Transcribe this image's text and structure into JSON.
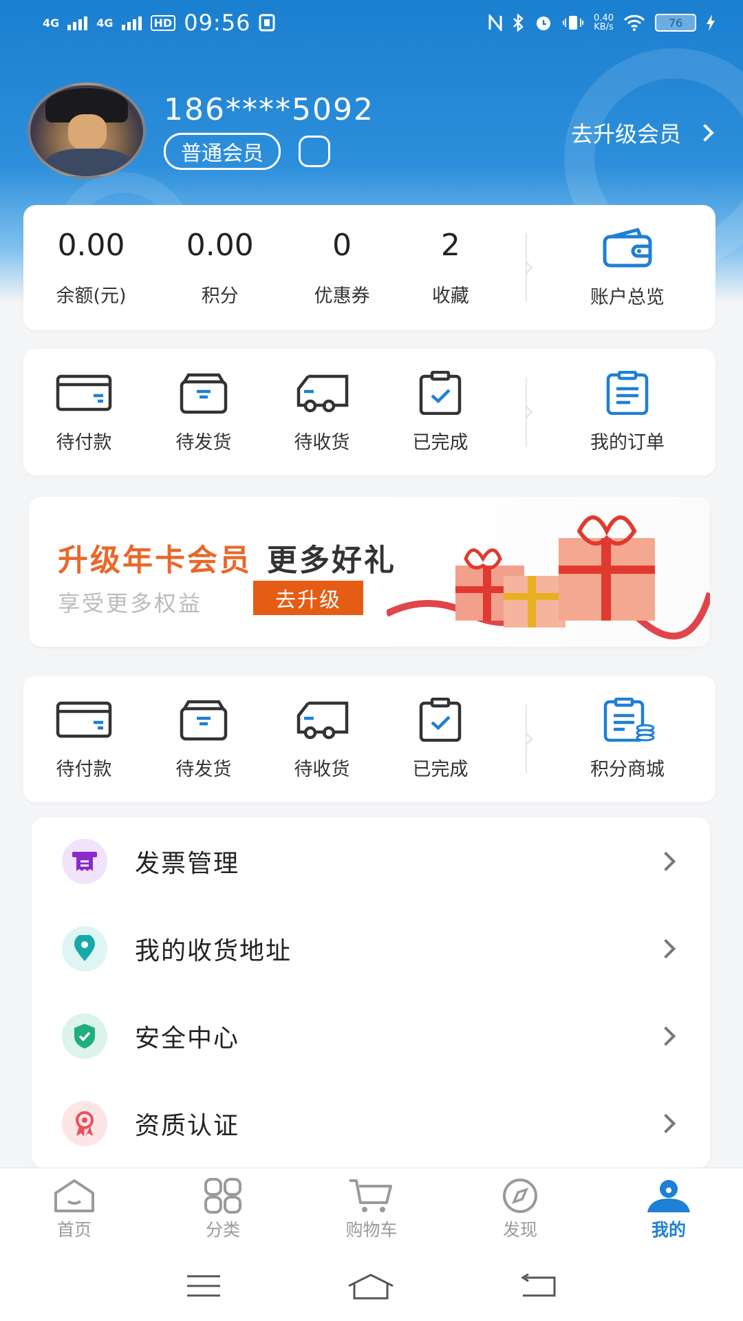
{
  "status_bar": {
    "net1": "4G",
    "net2": "4G",
    "hd": "HD",
    "time": "09:56",
    "speed_value": "0.40",
    "speed_unit": "KB/s",
    "battery": "76"
  },
  "profile": {
    "phone": "186****5092",
    "member_level": "普通会员",
    "upgrade_label": "去升级会员"
  },
  "stats": [
    {
      "value": "0.00",
      "label": "余额(元)"
    },
    {
      "value": "0.00",
      "label": "积分"
    },
    {
      "value": "0",
      "label": "优惠券"
    },
    {
      "value": "2",
      "label": "收藏"
    }
  ],
  "account_overview": "账户总览",
  "orders_1": {
    "items": [
      "待付款",
      "待发货",
      "待收货",
      "已完成"
    ],
    "right": "我的订单"
  },
  "banner": {
    "title_orange": "升级年卡会员",
    "title_dark": "更多好礼",
    "subtitle": "享受更多权益",
    "button": "去升级"
  },
  "orders_2": {
    "items": [
      "待付款",
      "待发货",
      "待收货",
      "已完成"
    ],
    "right": "积分商城"
  },
  "menu": [
    {
      "label": "发票管理",
      "icon": "invoice-icon",
      "color": "#8a2bc8"
    },
    {
      "label": "我的收货地址",
      "icon": "location-pin-icon",
      "color": "#16a9a8"
    },
    {
      "label": "安全中心",
      "icon": "shield-check-icon",
      "color": "#1fae7e"
    },
    {
      "label": "资质认证",
      "icon": "award-ribbon-icon",
      "color": "#e8505b"
    }
  ],
  "tabs": [
    {
      "label": "首页",
      "icon": "home-icon"
    },
    {
      "label": "分类",
      "icon": "category-grid-icon"
    },
    {
      "label": "购物车",
      "icon": "cart-icon"
    },
    {
      "label": "发现",
      "icon": "compass-icon"
    },
    {
      "label": "我的",
      "icon": "user-icon",
      "active": true
    }
  ],
  "colors": {
    "primary_blue": "#1b7fd0",
    "accent_orange": "#e55c14",
    "active_tab": "#1e7fd6"
  }
}
